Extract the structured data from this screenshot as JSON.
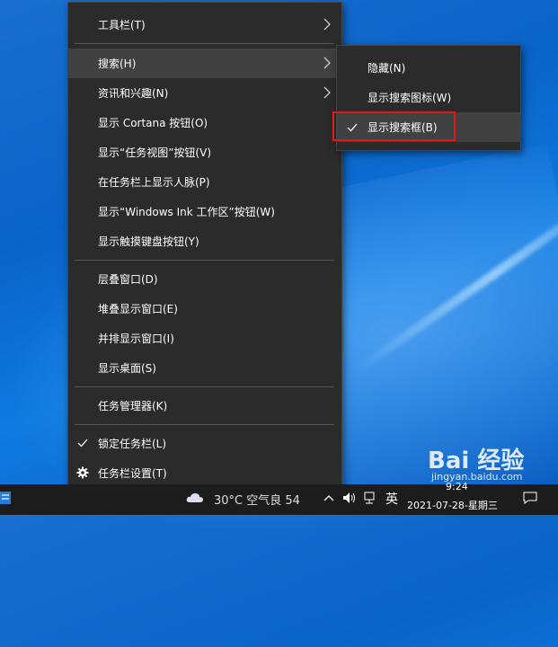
{
  "main_menu": {
    "items": [
      {
        "label": "工具栏(T)",
        "submenu": true
      },
      {
        "label": "搜索(H)",
        "submenu": true,
        "active": true
      },
      {
        "label": "资讯和兴趣(N)",
        "submenu": true
      },
      {
        "label": "显示 Cortana 按钮(O)"
      },
      {
        "label": "显示“任务视图”按钮(V)"
      },
      {
        "label": "在任务栏上显示人脉(P)"
      },
      {
        "label": "显示“Windows Ink 工作区”按钮(W)"
      },
      {
        "label": "显示触摸键盘按钮(Y)"
      },
      {
        "label": "层叠窗口(D)"
      },
      {
        "label": "堆叠显示窗口(E)"
      },
      {
        "label": "并排显示窗口(I)"
      },
      {
        "label": "显示桌面(S)"
      },
      {
        "label": "任务管理器(K)"
      },
      {
        "label": "锁定任务栏(L)",
        "checked": true
      },
      {
        "label": "任务栏设置(T)",
        "icon": "gear-icon"
      }
    ]
  },
  "sub_menu": {
    "items": [
      {
        "label": "隐藏(N)"
      },
      {
        "label": "显示搜索图标(W)"
      },
      {
        "label": "显示搜索框(B)",
        "checked": true,
        "active": true
      }
    ]
  },
  "taskbar": {
    "weather": "30°C  空气良 54",
    "ime": "英",
    "time": "9:24",
    "date": "2021-07-28-星期三"
  },
  "watermark": {
    "brand": "Bai 经验",
    "url": "jingyan.baidu.com"
  },
  "colors": {
    "menu_bg": "#2b2b2b",
    "highlight_border": "#e01919",
    "desktop": "#0a63c8"
  }
}
